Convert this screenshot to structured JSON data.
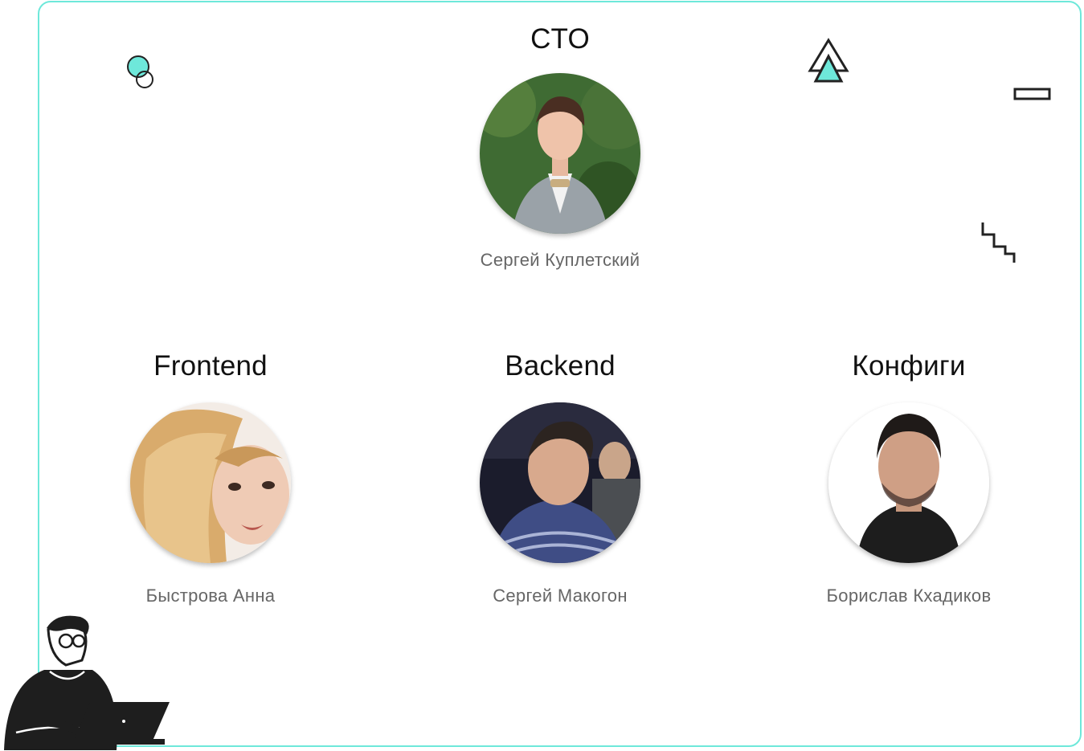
{
  "team": {
    "cto": {
      "role": "CTO",
      "name": "Сергей Куплетский"
    },
    "frontend": {
      "role": "Frontend",
      "name": "Быстрова Анна"
    },
    "backend": {
      "role": "Backend",
      "name": "Сергей Макогон"
    },
    "configs": {
      "role": "Конфиги",
      "name": "Борислав Кхадиков"
    }
  },
  "colors": {
    "accent": "#6ee8da",
    "role_text": "#111111",
    "name_text": "#666666",
    "frame_border": "#6ee8da"
  },
  "icons": {
    "bubbles": "bubbles-icon",
    "triangle": "triangle-icon",
    "rectangle": "rectangle-icon",
    "steps": "steps-icon",
    "illustration": "developer-with-laptop-illustration"
  }
}
